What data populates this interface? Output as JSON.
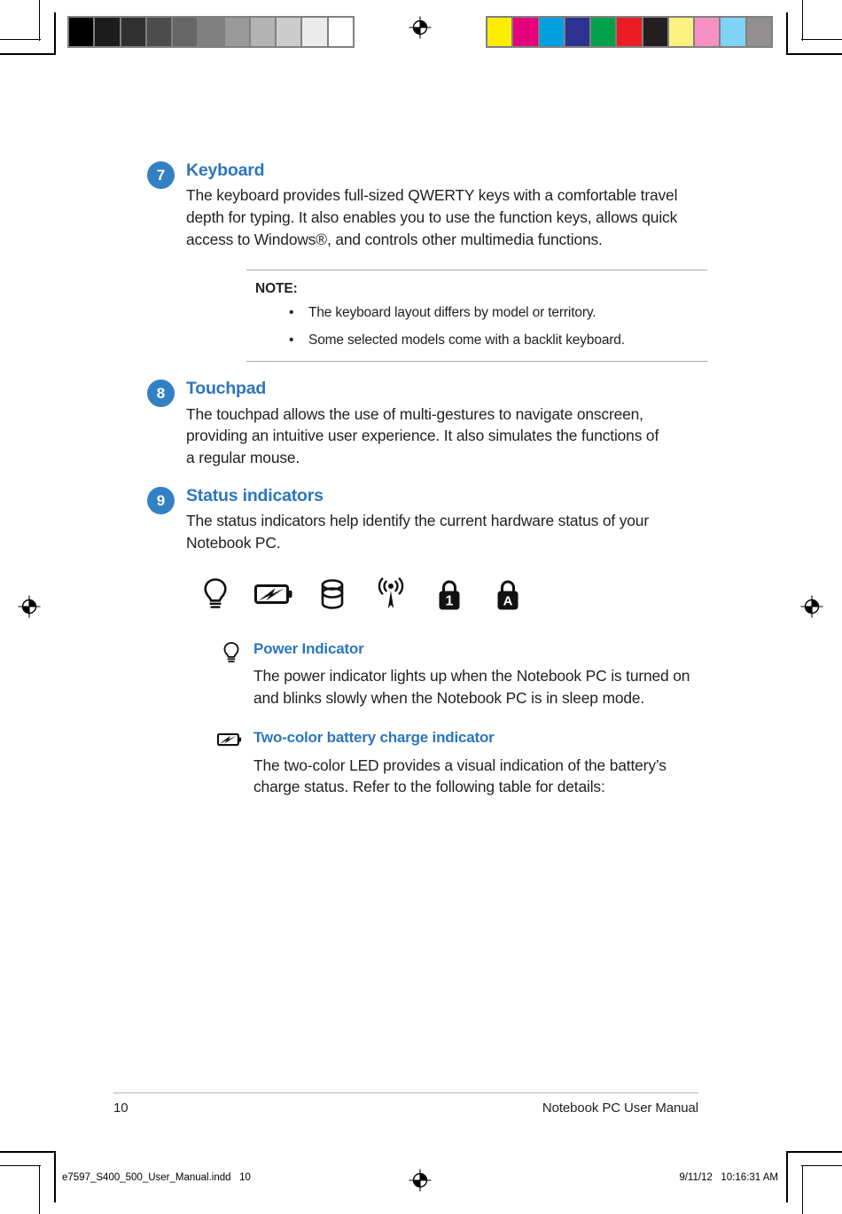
{
  "printer_marks": {
    "grayscale_swatches": [
      "#000000",
      "#1c1c1c",
      "#303030",
      "#4c4c4c",
      "#666666",
      "#808080",
      "#999999",
      "#b3b3b3",
      "#cccccc",
      "#ebebeb",
      "#ffffff"
    ],
    "color_swatches": [
      "#ffed00",
      "#e5007e",
      "#00a0e1",
      "#2e3192",
      "#00a14b",
      "#ed1c24",
      "#231f20",
      "#fbf080",
      "#f691c4",
      "#7fd3f5",
      "#918f90"
    ],
    "registration_mark_name": "registration-target"
  },
  "sections": [
    {
      "number": "7",
      "title": "Keyboard",
      "text": "The keyboard provides full-sized QWERTY keys with a comfortable travel depth for typing. It also enables you to use the function keys, allows quick access to Windows®, and controls other multimedia functions."
    },
    {
      "number": "8",
      "title": "Touchpad",
      "text": "The touchpad allows the use of multi-gestures to navigate onscreen, providing an intuitive user experience. It also simulates the functions of a regular mouse."
    },
    {
      "number": "9",
      "title": "Status indicators",
      "text": "The status indicators help identify the current hardware status of your Notebook PC."
    }
  ],
  "note": {
    "title": "NOTE:",
    "bullet": "•",
    "items": [
      "The keyboard layout differs by model or territory.",
      "Some selected models come with a backlit keyboard."
    ]
  },
  "status_icons": [
    {
      "name": "power-indicator-icon",
      "label": "Power indicator"
    },
    {
      "name": "battery-charge-icon",
      "label": "Two-color battery charge indicator"
    },
    {
      "name": "drive-activity-icon",
      "label": "Drive activity indicator"
    },
    {
      "name": "wireless-bluetooth-icon",
      "label": "Bluetooth / Wireless indicator"
    },
    {
      "name": "number-lock-icon",
      "label": "Number lock"
    },
    {
      "name": "capital-lock-icon",
      "label": "Capital lock"
    }
  ],
  "subsections": [
    {
      "icon": "power-indicator-icon",
      "title": "Power Indicator",
      "text": "The power indicator lights up when the Notebook PC is turned on and blinks slowly when the Notebook PC is in sleep mode."
    },
    {
      "icon": "battery-charge-icon",
      "title": "Two-color battery charge indicator",
      "text": "The two-color LED provides a visual indication of the battery’s charge status. Refer to the following table for details:"
    }
  ],
  "footer": {
    "page_number": "10",
    "manual_title": "Notebook PC User Manual"
  },
  "print_slug": {
    "filename": "e7597_S400_500_User_Manual.indd   10",
    "timestamp": "9/11/12   10:16:31 AM"
  },
  "colors": {
    "accent_blue": "#2c76bd",
    "badge_blue": "#3380c4",
    "text": "#231f20",
    "rule_gray": "#a7a9ac"
  }
}
